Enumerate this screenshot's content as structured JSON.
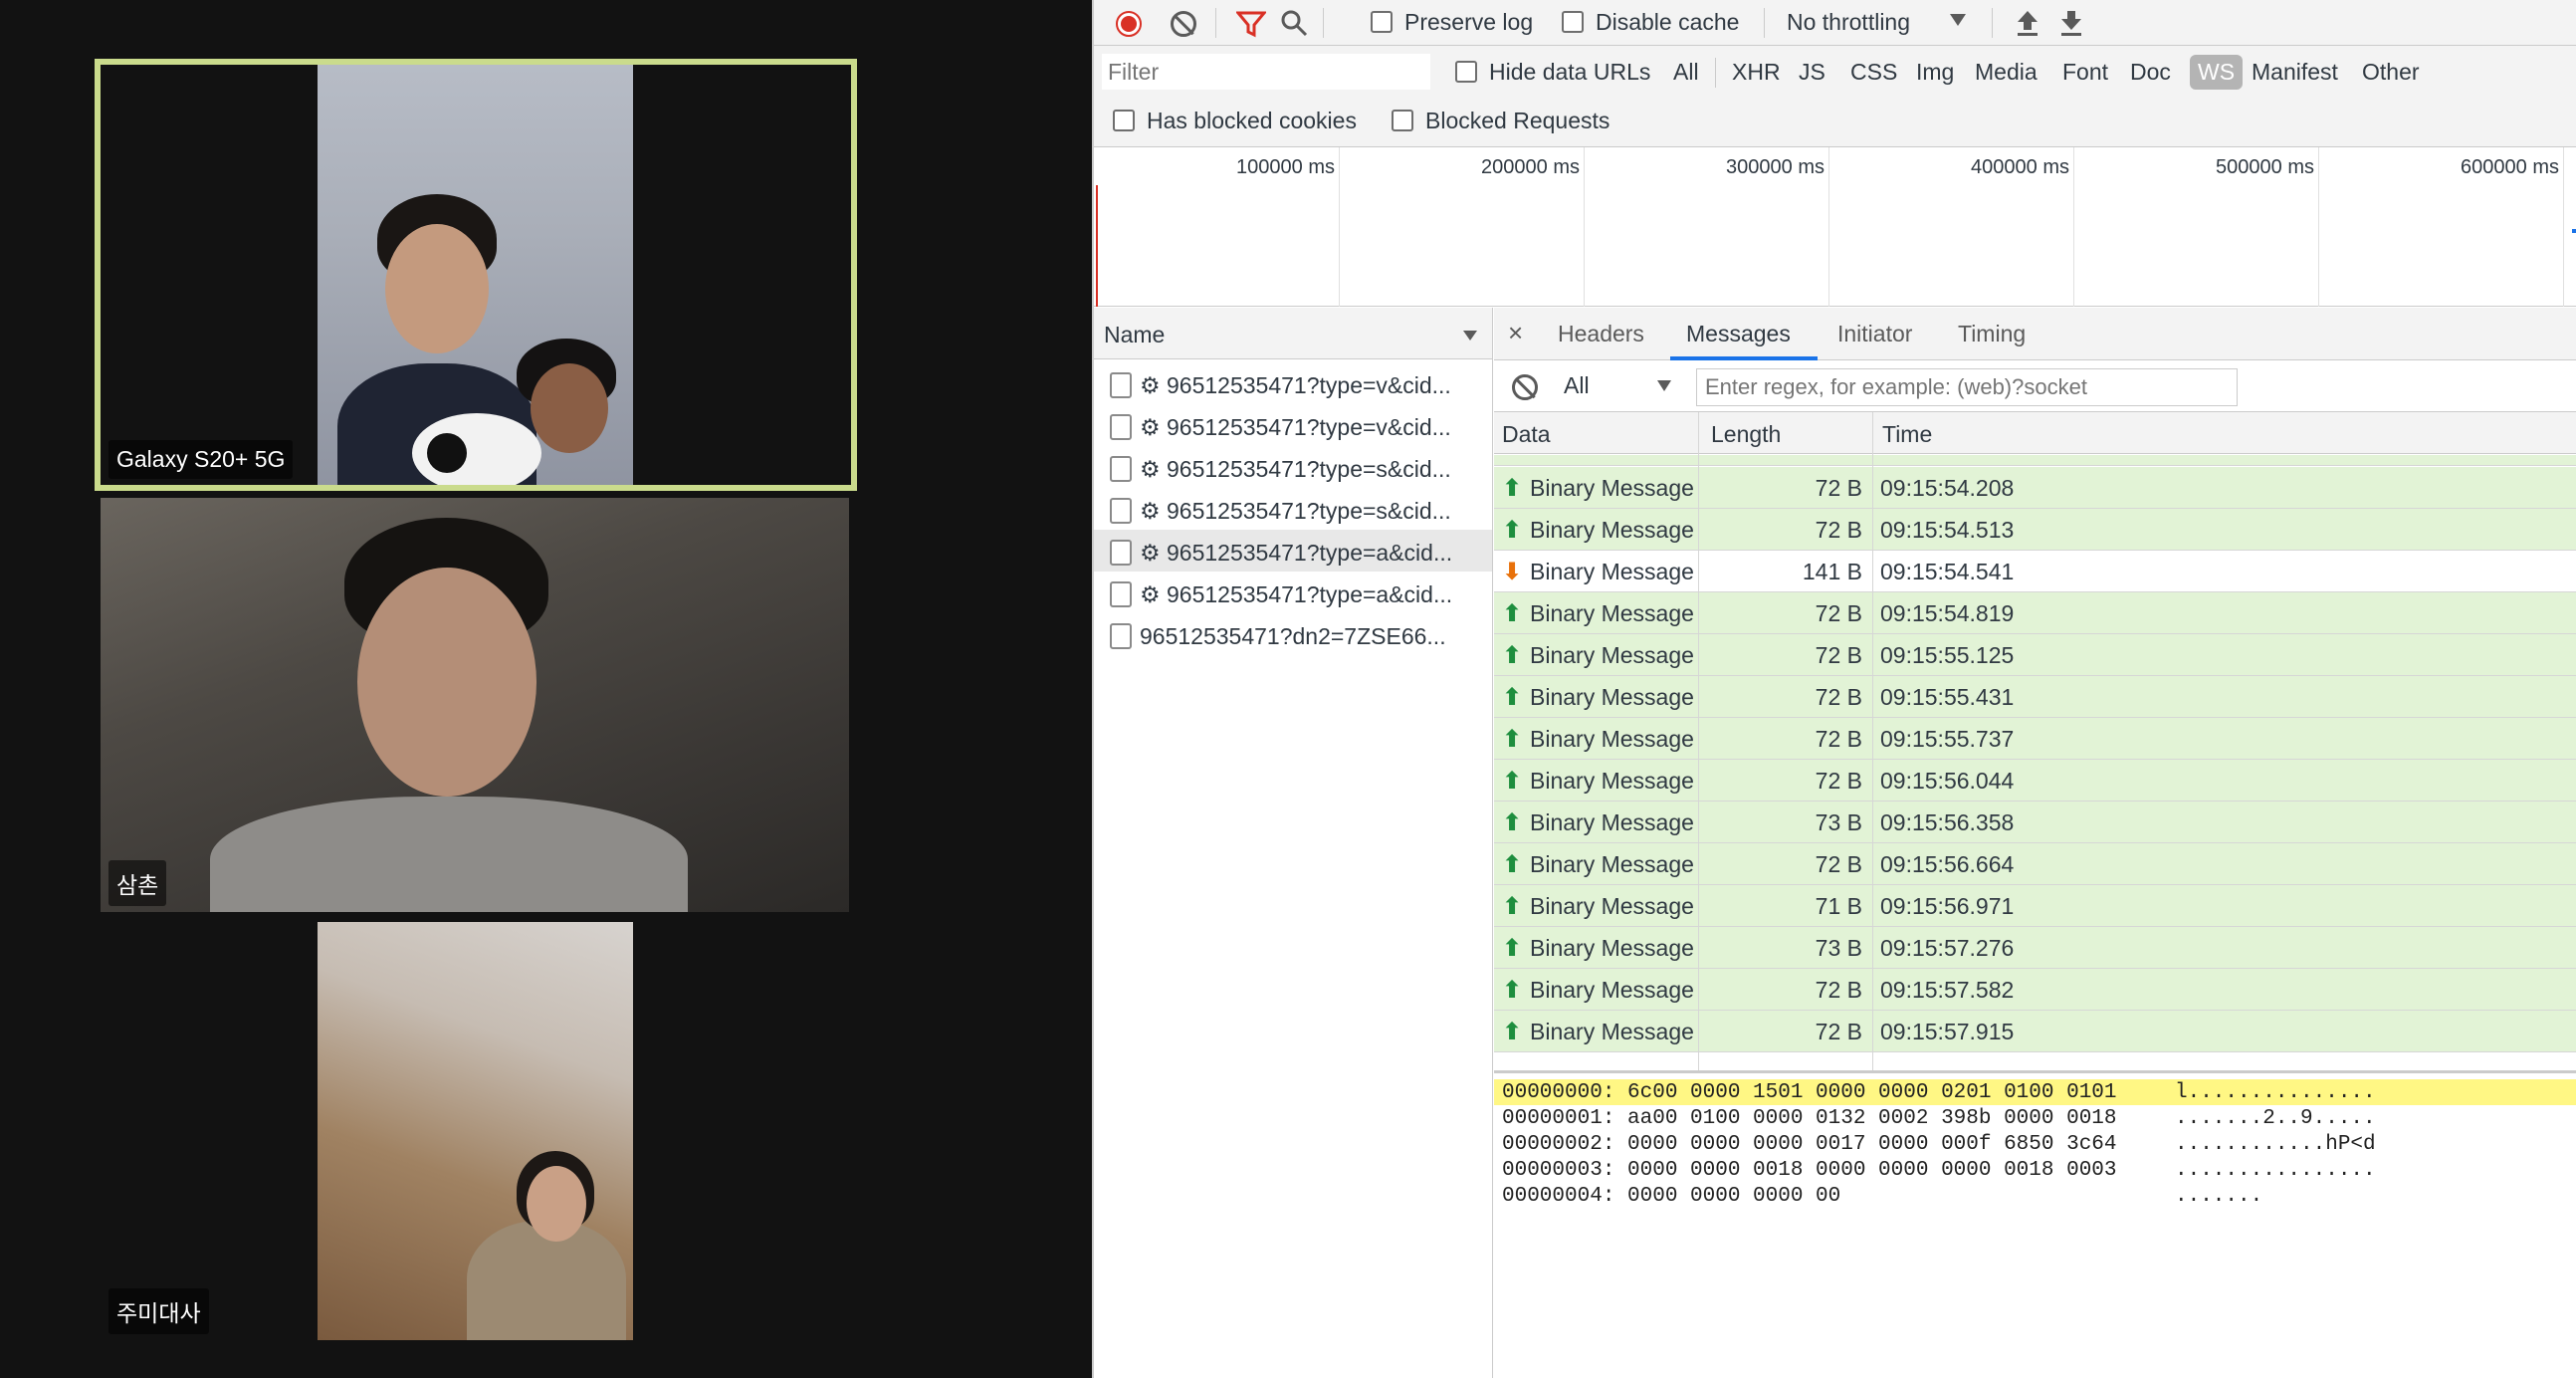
{
  "video": {
    "tiles": [
      {
        "name": "Galaxy S20+ 5G"
      },
      {
        "name": "삼촌"
      },
      {
        "name": "주미대사"
      }
    ],
    "active_speaker_color": "#cadb8c"
  },
  "devtools": {
    "toolbar": {
      "preserve_log": {
        "label": "Preserve log",
        "checked": false
      },
      "disable_cache": {
        "label": "Disable cache",
        "checked": false
      },
      "throttling": "No throttling",
      "record_icon": "record-icon",
      "clear_icon": "clear-icon",
      "filter_icon": "filter-icon",
      "search_icon": "search-icon",
      "import_icon": "upload-icon",
      "export_icon": "download-icon"
    },
    "filter": {
      "placeholder": "Filter",
      "hide_data_urls": {
        "label": "Hide data URLs",
        "checked": false
      },
      "types": [
        "All",
        "XHR",
        "JS",
        "CSS",
        "Img",
        "Media",
        "Font",
        "Doc",
        "WS",
        "Manifest",
        "Other"
      ],
      "active_type": "WS",
      "has_blocked_cookies": {
        "label": "Has blocked cookies",
        "checked": false
      },
      "blocked_requests": {
        "label": "Blocked Requests",
        "checked": false
      }
    },
    "overview": {
      "ticks": [
        "100000 ms",
        "200000 ms",
        "300000 ms",
        "400000 ms",
        "500000 ms",
        "600000 ms"
      ]
    },
    "requests": {
      "column": "Name",
      "items": [
        {
          "label": "⚙ 96512535471?type=v&cid..."
        },
        {
          "label": "⚙ 96512535471?type=v&cid..."
        },
        {
          "label": "⚙ 96512535471?type=s&cid..."
        },
        {
          "label": "⚙ 96512535471?type=s&cid..."
        },
        {
          "label": "⚙ 96512535471?type=a&cid..."
        },
        {
          "label": "⚙ 96512535471?type=a&cid..."
        },
        {
          "label": "96512535471?dn2=7ZSE66..."
        }
      ],
      "selected_index": 4
    },
    "detail": {
      "close": "×",
      "tabs": [
        "Headers",
        "Messages",
        "Initiator",
        "Timing"
      ],
      "active_tab": "Messages",
      "message_filter": "All",
      "regex_placeholder": "Enter regex, for example: (web)?socket",
      "columns": {
        "data": "Data",
        "length": "Length",
        "time": "Time"
      },
      "messages": [
        {
          "dir": "sent",
          "data": "Binary Message",
          "length": "72 B",
          "time": "09:15:54.208"
        },
        {
          "dir": "sent",
          "data": "Binary Message",
          "length": "72 B",
          "time": "09:15:54.513"
        },
        {
          "dir": "recv",
          "data": "Binary Message",
          "length": "141 B",
          "time": "09:15:54.541"
        },
        {
          "dir": "sent",
          "data": "Binary Message",
          "length": "72 B",
          "time": "09:15:54.819"
        },
        {
          "dir": "sent",
          "data": "Binary Message",
          "length": "72 B",
          "time": "09:15:55.125"
        },
        {
          "dir": "sent",
          "data": "Binary Message",
          "length": "72 B",
          "time": "09:15:55.431"
        },
        {
          "dir": "sent",
          "data": "Binary Message",
          "length": "72 B",
          "time": "09:15:55.737"
        },
        {
          "dir": "sent",
          "data": "Binary Message",
          "length": "72 B",
          "time": "09:15:56.044"
        },
        {
          "dir": "sent",
          "data": "Binary Message",
          "length": "73 B",
          "time": "09:15:56.358"
        },
        {
          "dir": "sent",
          "data": "Binary Message",
          "length": "72 B",
          "time": "09:15:56.664"
        },
        {
          "dir": "sent",
          "data": "Binary Message",
          "length": "71 B",
          "time": "09:15:56.971"
        },
        {
          "dir": "sent",
          "data": "Binary Message",
          "length": "73 B",
          "time": "09:15:57.276"
        },
        {
          "dir": "sent",
          "data": "Binary Message",
          "length": "72 B",
          "time": "09:15:57.582"
        },
        {
          "dir": "sent",
          "data": "Binary Message",
          "length": "72 B",
          "time": "09:15:57.915"
        }
      ],
      "hex": [
        {
          "addr": "00000000:",
          "bytes": "6c00 0000 1501 0000 0000 0201 0100 0101",
          "ascii": "l..............."
        },
        {
          "addr": "00000001:",
          "bytes": "aa00 0100 0000 0132 0002 398b 0000 0018",
          "ascii": ".......2..9....."
        },
        {
          "addr": "00000002:",
          "bytes": "0000 0000 0000 0017 0000 000f 6850 3c64",
          "ascii": "............hP<d"
        },
        {
          "addr": "00000003:",
          "bytes": "0000 0000 0018 0000 0000 0000 0018 0003",
          "ascii": "................"
        },
        {
          "addr": "00000004:",
          "bytes": "0000 0000 0000 00",
          "ascii": "......."
        }
      ]
    }
  }
}
